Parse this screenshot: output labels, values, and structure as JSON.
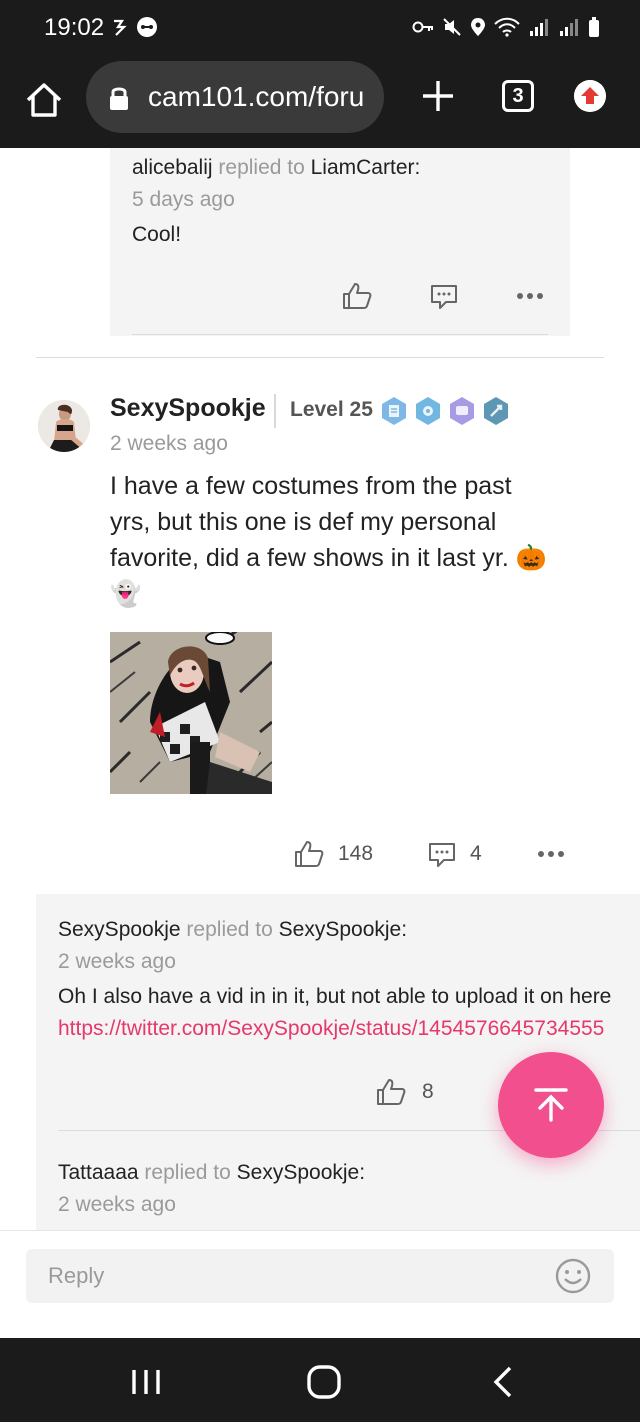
{
  "status_bar": {
    "time": "19:02"
  },
  "browser": {
    "url": "cam101.com/foru",
    "tab_count": "3"
  },
  "first_reply": {
    "author": "alicebalij",
    "replied_to_text": "replied to",
    "target": "LiamCarter:",
    "time": "5 days ago",
    "text": "Cool!"
  },
  "post": {
    "author": "SexySpookje",
    "level": "Level 25",
    "time": "2 weeks ago",
    "text_line1": "I have a few costumes from the past",
    "text_line2": "yrs, but this one is def my personal",
    "text_line3": "favorite, did a few shows in it last yr. 🎃",
    "text_line4": "👻",
    "likes": "148",
    "comments": "4"
  },
  "replies": [
    {
      "author": "SexySpookje",
      "replied_to_text": "replied to",
      "target": "SexySpookje:",
      "time": "2 weeks ago",
      "text": "Oh I also have a vid in in it, but not able to upload it on here",
      "link": "https://twitter.com/SexySpookje/status/1454576645734555",
      "likes": "8"
    },
    {
      "author": "Tattaaaa",
      "replied_to_text": "replied to",
      "target": "SexySpookje:",
      "time": "2 weeks ago"
    }
  ],
  "reply_bar": {
    "placeholder": "Reply"
  },
  "colors": {
    "accent": "#f24f8e",
    "link": "#e6386b",
    "bar": "#1b1b1b"
  },
  "icons": [
    "home-icon",
    "lock-icon",
    "plus-icon",
    "tabs-icon",
    "update-icon",
    "thumbs-up-icon",
    "comment-icon",
    "more-icon",
    "scroll-top-icon",
    "emoji-icon",
    "recents-icon",
    "home-nav-icon",
    "back-icon"
  ]
}
